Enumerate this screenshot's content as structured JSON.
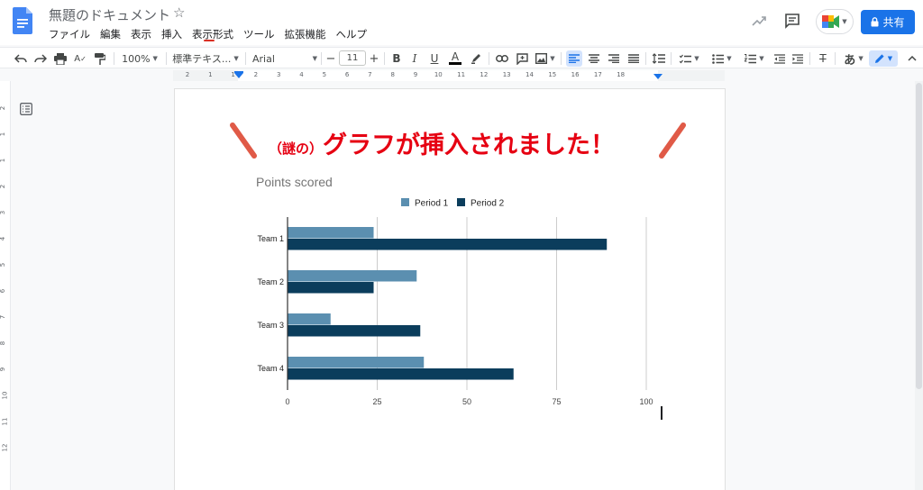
{
  "titlebar": {
    "doc_title": "無題のドキュメント",
    "star": "☆",
    "menus": [
      "ファイル",
      "編集",
      "表示",
      "挿入",
      "表示形式",
      "ツール",
      "拡張機能",
      "ヘルプ"
    ],
    "share_label": "共有"
  },
  "toolbar": {
    "zoom": "100%",
    "style": "標準テキス...",
    "font": "Arial",
    "font_size": "11",
    "minus": "−",
    "plus": "+",
    "bold": "B",
    "italic": "I",
    "underline": "U",
    "text_color": "A",
    "clear": "T̶",
    "ime": "あ"
  },
  "ruler": {
    "numbers": [
      "2",
      "1",
      "1",
      "2",
      "3",
      "4",
      "5",
      "6",
      "7",
      "8",
      "9",
      "10",
      "11",
      "12",
      "13",
      "14",
      "15",
      "16",
      "17",
      "18"
    ],
    "vnumbers": [
      "2",
      "1",
      "1",
      "2",
      "3",
      "4",
      "5",
      "6",
      "7",
      "8",
      "9",
      "10",
      "11",
      "12"
    ]
  },
  "annotation": {
    "prefix": "（謎の）",
    "main": "グラフが挿入されました！"
  },
  "chart_data": {
    "type": "bar",
    "orientation": "horizontal",
    "title": "Points scored",
    "categories": [
      "Team 1",
      "Team 2",
      "Team 3",
      "Team 4"
    ],
    "series": [
      {
        "name": "Period 1",
        "values": [
          24,
          36,
          12,
          38
        ],
        "color": "#5b8fb0"
      },
      {
        "name": "Period 2",
        "values": [
          89,
          24,
          37,
          63
        ],
        "color": "#0b3d5c"
      }
    ],
    "xlim": [
      0,
      100
    ],
    "xticks": [
      0,
      25,
      50,
      75,
      100
    ],
    "grid": true,
    "legend": "top"
  },
  "colors": {
    "accent": "#1a73e8",
    "annotation": "#e60012",
    "annotation_slash": "#e05a47"
  }
}
